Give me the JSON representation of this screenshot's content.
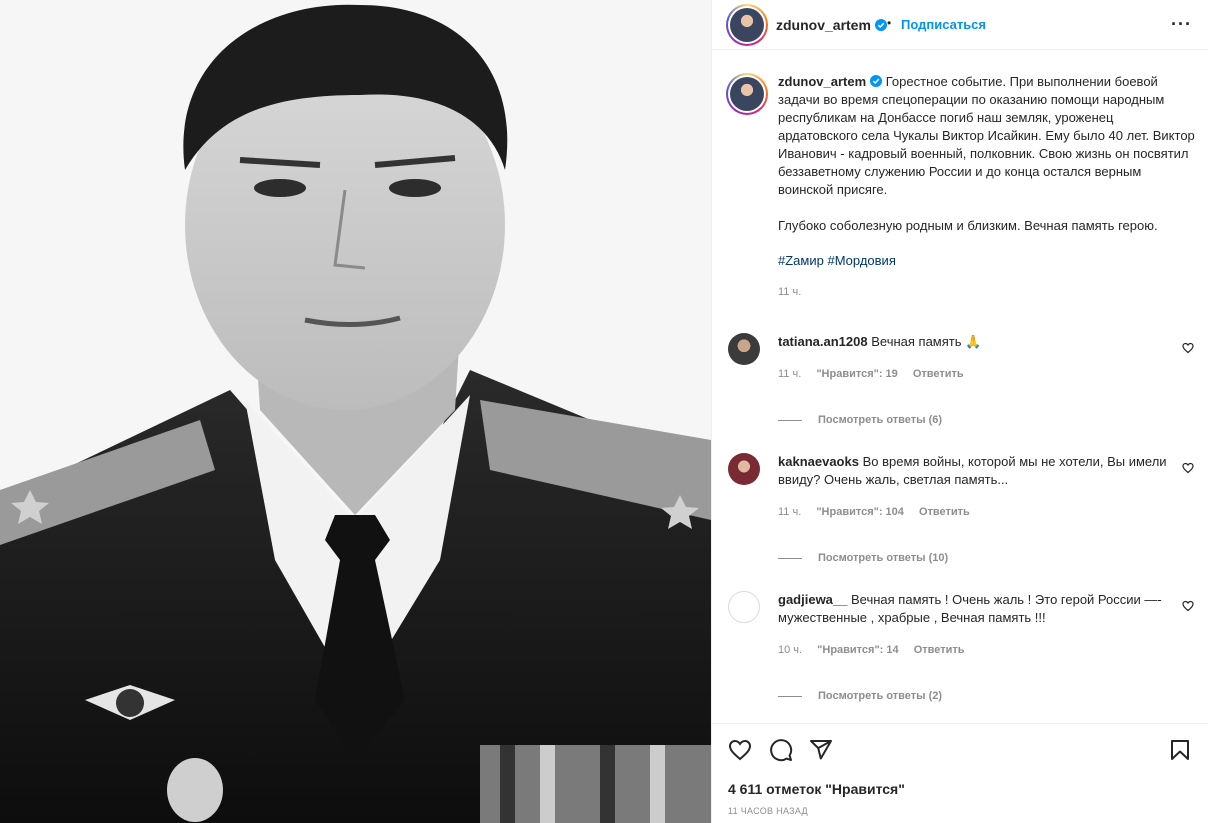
{
  "post": {
    "username": "zdunov_artem",
    "follow_label": "Подписаться",
    "separator": "•",
    "more_label": "···",
    "caption_p1": "Горестное событие. При выполнении боевой задачи во время спецоперации по оказанию помощи народным республикам на Донбассе погиб наш земляк, уроженец ардатовского села Чукалы Виктор Исайкин. Ему было 40 лет. Виктор Иванович - кадровый военный, полковник. Свою жизнь он посвятил беззаветному служению России и до конца остался верным воинской присяге.",
    "caption_p2": "Глубоко соболезную родным и близким. Вечная память герою.",
    "tag1": "#Zамир",
    "tag2": "#Мордовия",
    "caption_time": "11 ч."
  },
  "comments": [
    {
      "user": "tatiana.an1208",
      "text": "Вечная память 🙏",
      "time": "11 ч.",
      "likes": "\"Нравится\": 19",
      "reply": "Ответить",
      "view_replies": "Посмотреть ответы (6)"
    },
    {
      "user": "kaknaevaoks",
      "text": "Во время войны, которой мы не хотели, Вы имели ввиду? Очень жаль, светлая память...",
      "time": "11 ч.",
      "likes": "\"Нравится\": 104",
      "reply": "Ответить",
      "view_replies": "Посмотреть ответы (10)"
    },
    {
      "user": "gadjiewa__",
      "text": "Вечная память ! Очень жаль ! Это герой России —- мужественные , храбрые , Вечная память !!!",
      "time": "10 ч.",
      "likes": "\"Нравится\": 14",
      "reply": "Ответить",
      "view_replies": "Посмотреть ответы (2)"
    }
  ],
  "footer": {
    "likes_count": "4 611 отметок \"Нравится\"",
    "posted_ago": "11 ЧАСОВ НАЗАД"
  },
  "colors": {
    "link_blue": "#0095f6",
    "hashtag": "#00376b",
    "muted": "#8e8e8e",
    "verified": "#0095f6"
  },
  "icons": [
    "more-icon",
    "verified-icon",
    "heart-icon",
    "comment-icon",
    "share-icon",
    "bookmark-icon",
    "comment-heart-icon"
  ]
}
